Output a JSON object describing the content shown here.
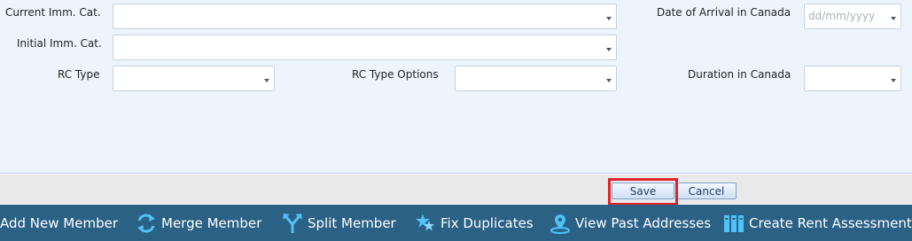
{
  "form": {
    "current_imm_cat_label": "Current Imm. Cat.",
    "current_imm_cat_value": "",
    "initial_imm_cat_label": "Initial Imm. Cat.",
    "initial_imm_cat_value": "",
    "rc_type_label": "RC Type",
    "rc_type_value": "",
    "rc_type_options_label": "RC Type Options",
    "rc_type_options_value": "",
    "date_of_arrival_label": "Date of Arrival in Canada",
    "date_of_arrival_placeholder": "dd/mm/yyyy",
    "duration_label": "Duration in Canada",
    "duration_value": ""
  },
  "buttons": {
    "save_label": "Save",
    "cancel_label": "Cancel"
  },
  "toolbar": {
    "items": [
      {
        "label": "Add New Member",
        "icon": "add-member-icon"
      },
      {
        "label": "Merge Member",
        "icon": "merge-icon"
      },
      {
        "label": "Split Member",
        "icon": "split-icon"
      },
      {
        "label": "Fix Duplicates",
        "icon": "fix-duplicates-icon"
      },
      {
        "label": "View Past Addresses",
        "icon": "map-pin-icon"
      },
      {
        "label": "Create Rent Assessment",
        "icon": "binders-icon"
      }
    ]
  },
  "colors": {
    "form_background": "#eef4fc",
    "toolbar_background": "#2a6185",
    "highlight": "#e0232b",
    "icon_accent": "#4fc3f7"
  }
}
